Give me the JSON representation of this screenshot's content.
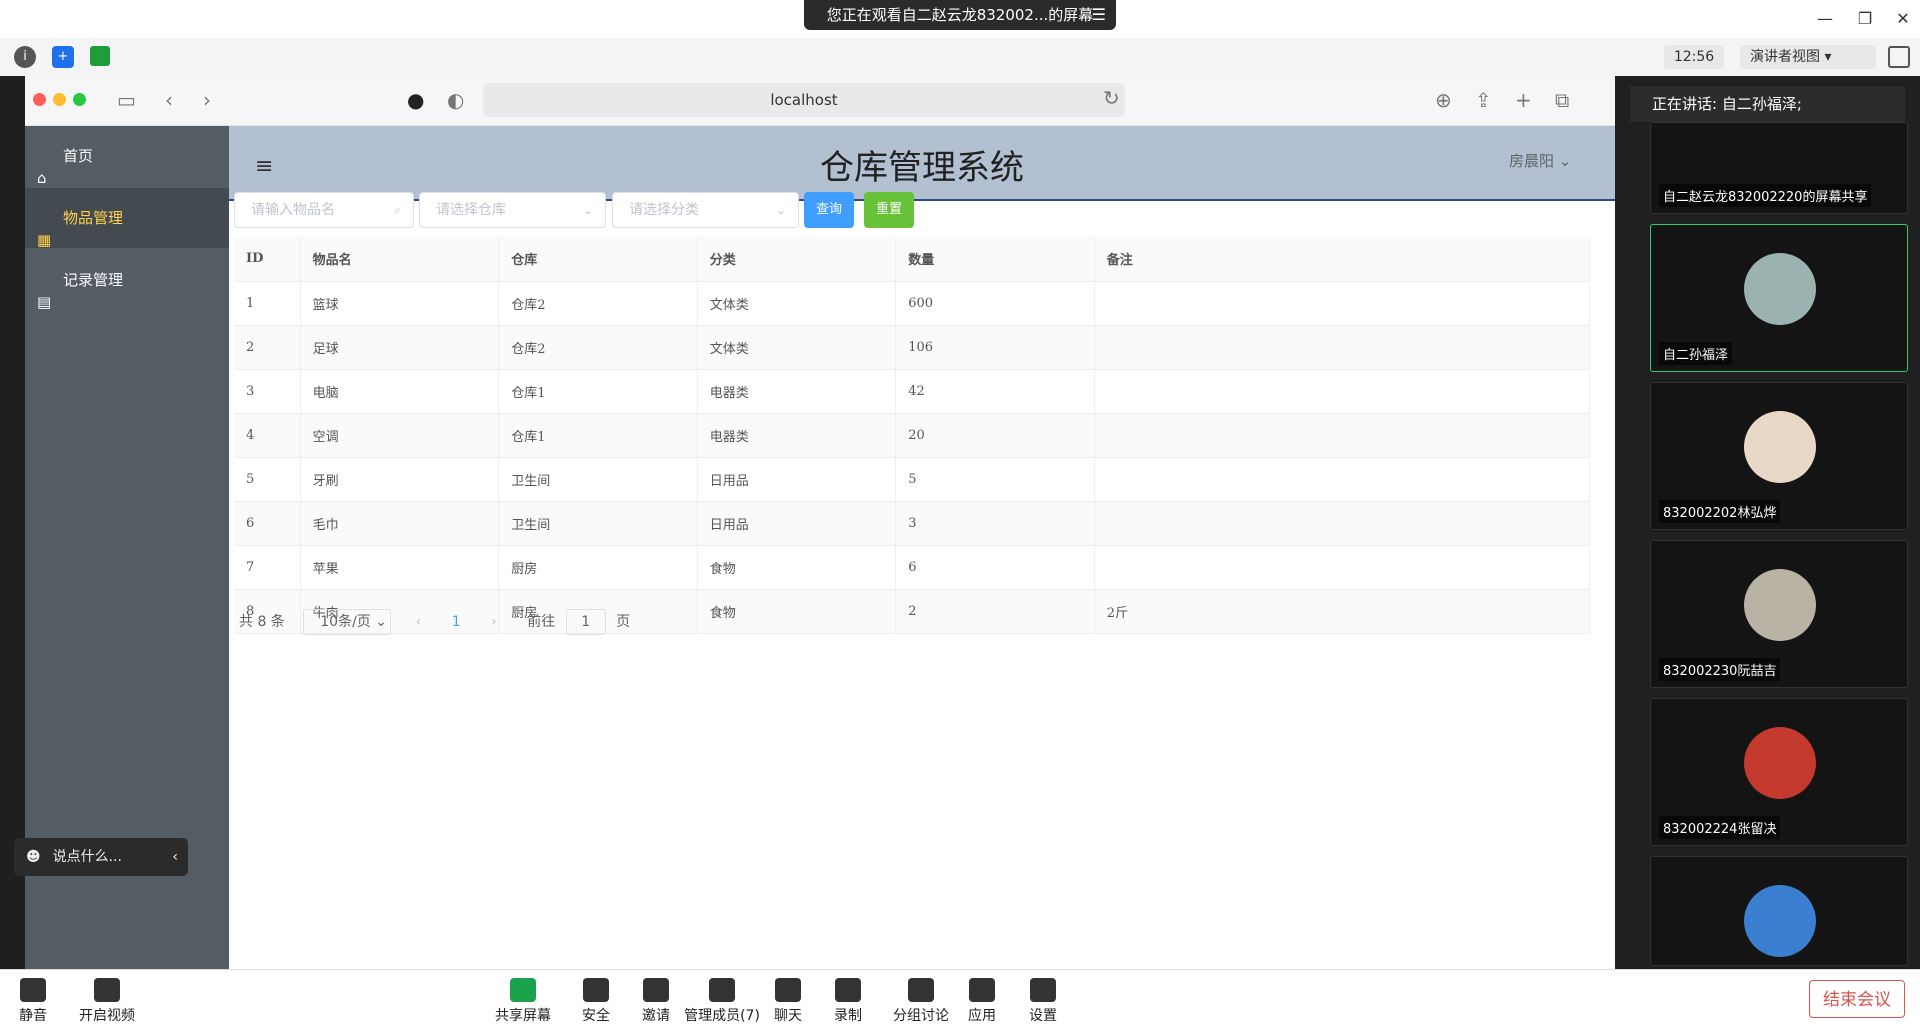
{
  "meeting": {
    "share_banner": "您正在观看自二赵云龙832002...的屏幕",
    "clock": "12:56",
    "speaker_view": "演讲者视图",
    "talking": "正在讲话: 自二孙福泽;",
    "chat_placeholder": "说点什么...",
    "end_label": "结束会议",
    "bottom_tools": [
      "静音",
      "开启视频",
      "共享屏幕",
      "安全",
      "邀请",
      "管理成员(7)",
      "聊天",
      "录制",
      "分组讨论",
      "应用",
      "设置"
    ],
    "participants": [
      {
        "name": "自二赵云龙832002220的屏幕共享"
      },
      {
        "name": "自二孙福泽"
      },
      {
        "name": "832002202林弘烨"
      },
      {
        "name": "832002230阮喆吉"
      },
      {
        "name": "832002224张留决"
      }
    ]
  },
  "browser": {
    "url": "localhost"
  },
  "app": {
    "title": "仓库管理系统",
    "user": "房晨阳",
    "menu": [
      {
        "label": "首页"
      },
      {
        "label": "物品管理"
      },
      {
        "label": "记录管理"
      }
    ],
    "filters": {
      "name_placeholder": "请输入物品名",
      "warehouse_placeholder": "请选择仓库",
      "category_placeholder": "请选择分类",
      "query_label": "查询",
      "reset_label": "重置"
    },
    "table": {
      "headers": [
        "ID",
        "物品名",
        "仓库",
        "分类",
        "数量",
        "备注"
      ],
      "rows": [
        [
          "1",
          "篮球",
          "仓库2",
          "文体类",
          "600",
          ""
        ],
        [
          "2",
          "足球",
          "仓库2",
          "文体类",
          "106",
          ""
        ],
        [
          "3",
          "电脑",
          "仓库1",
          "电器类",
          "42",
          ""
        ],
        [
          "4",
          "空调",
          "仓库1",
          "电器类",
          "20",
          ""
        ],
        [
          "5",
          "牙刷",
          "卫生间",
          "日用品",
          "5",
          ""
        ],
        [
          "6",
          "毛巾",
          "卫生间",
          "日用品",
          "3",
          ""
        ],
        [
          "7",
          "苹果",
          "厨房",
          "食物",
          "6",
          ""
        ],
        [
          "8",
          "牛肉",
          "厨房",
          "食物",
          "2",
          "2斤"
        ]
      ]
    },
    "pagination": {
      "total": "共 8 条",
      "page_size": "10条/页",
      "current": "1",
      "goto_label": "前往",
      "goto_value": "1",
      "page_suffix": "页"
    }
  }
}
